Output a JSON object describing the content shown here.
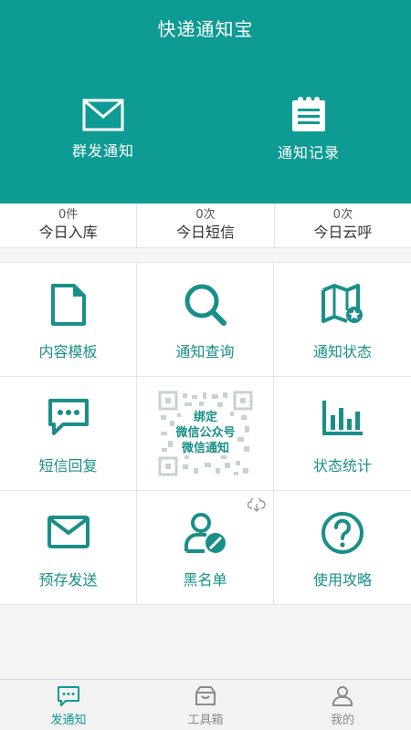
{
  "header": {
    "title": "快递通知宝",
    "actions": [
      {
        "label": "群发通知",
        "icon": "envelope-icon"
      },
      {
        "label": "通知记录",
        "icon": "notepad-icon"
      }
    ]
  },
  "stats": [
    {
      "count": "0件",
      "label": "今日入库"
    },
    {
      "count": "0次",
      "label": "今日短信"
    },
    {
      "count": "0次",
      "label": "今日云呼"
    }
  ],
  "grid": {
    "content_template": "内容模板",
    "notify_query": "通知查询",
    "notify_status": "通知状态",
    "sms_reply": "短信回复",
    "qr_lines": [
      "绑定",
      "微信公众号",
      "微信通知"
    ],
    "status_stats": "状态统计",
    "pre_send": "预存发送",
    "blacklist": "黑名单",
    "usage_guide": "使用攻略"
  },
  "tabbar": {
    "tabs": [
      {
        "label": "发通知",
        "active": true
      },
      {
        "label": "工具箱",
        "active": false
      },
      {
        "label": "我的",
        "active": false
      }
    ]
  },
  "colors": {
    "primary": "#0e9b94",
    "icon": "#1a8f89",
    "tab_inactive": "#8a8a8a"
  }
}
